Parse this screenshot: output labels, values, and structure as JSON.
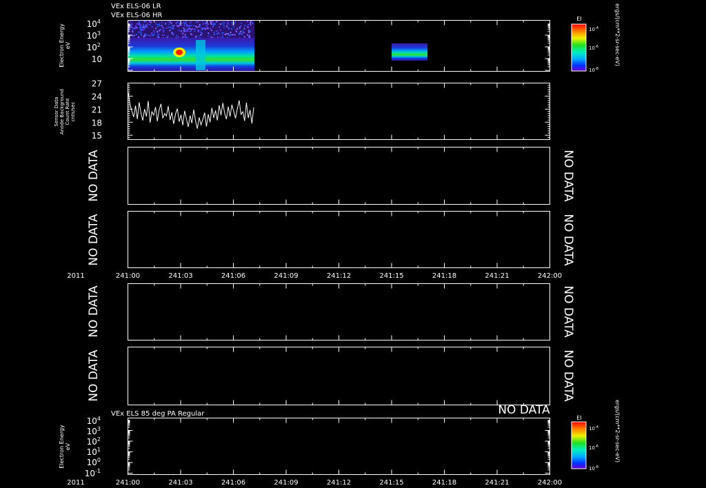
{
  "header": {
    "line1": "VEx ELS-06 LR",
    "line2": "VEx ELS-06 HR",
    "panel7_title": "VEx ELS 85 deg PA Regular"
  },
  "time_axis": {
    "year": "2011",
    "ticks": [
      "241:00",
      "241:03",
      "241:06",
      "241:09",
      "241:12",
      "241:15",
      "241:18",
      "241:21",
      "242:00"
    ]
  },
  "labels": {
    "electron_energy": "Electron Energy",
    "ev": "eV",
    "sensor_data": "Sensor Data",
    "anode_background": "Anode Background",
    "count_rate": "Count Rate",
    "cts_per_sec": "cnts/sec",
    "no_data": "NO DATA",
    "colorbar_title": "EI",
    "colorbar_units": "ergs/(cm**2-sr-sec-eV)"
  },
  "colors": {
    "background": "#000000",
    "foreground": "#ffffff",
    "spectrogram_palette": [
      "#5a00c8",
      "#0033ff",
      "#00a8ff",
      "#00f0c0",
      "#20e020",
      "#f0f000",
      "#ff8000",
      "#ff0000"
    ]
  },
  "chart_data": [
    {
      "type": "heatmap",
      "title": "VEx ELS-06 LR",
      "ylabel": "Electron Energy eV",
      "y_scale": "log",
      "yticks": [
        "10",
        "10²",
        "10³",
        "10⁴"
      ],
      "x_range": [
        "241:00",
        "242:00"
      ],
      "data_intervals": [
        {
          "start": "241:00:00",
          "end": "241:07:45",
          "note": "LR/HR spectrogram with peak flux near 241:03"
        },
        {
          "start": "241:15:10",
          "end": "241:17:00",
          "note": "short burst"
        }
      ],
      "colorbar": {
        "label": "EI",
        "ticks": [
          "10⁻⁴",
          "10⁻⁶",
          "10⁻⁸"
        ],
        "units": "ergs/(cm**2-sr-sec-eV)"
      }
    },
    {
      "type": "line",
      "ylabel": "Sensor Data Anode Background Count Rate cnts/sec",
      "ylim": [
        14,
        27
      ],
      "yticks": [
        15,
        18,
        21,
        24,
        27
      ],
      "x_range": [
        "241:00",
        "242:00"
      ],
      "series": [
        {
          "values": [
            24.8,
            22.1,
            20.5,
            19.2,
            21.8,
            18.7,
            22.6,
            20.1,
            18.4,
            21.0,
            19.3,
            22.9,
            17.9,
            20.4,
            19.6,
            21.5,
            18.2,
            20.8,
            22.2,
            18.9,
            20.0,
            19.4,
            21.7,
            18.5,
            20.3,
            17.6,
            19.9,
            21.1,
            18.1,
            19.7,
            17.3,
            20.6,
            18.8,
            16.9,
            19.5,
            17.8,
            20.9,
            18.3,
            16.5,
            19.1,
            17.4,
            18.6,
            20.2,
            17.0,
            19.8,
            18.0,
            21.3,
            19.0,
            20.7,
            18.4,
            21.9,
            19.6,
            22.4,
            20.1,
            18.7,
            21.6,
            19.3,
            22.0,
            20.5,
            18.9,
            21.2,
            23.0,
            19.8,
            20.4,
            18.3,
            22.5,
            19.0,
            20.8,
            17.7,
            21.4
          ]
        }
      ]
    },
    {
      "type": "table",
      "status": "NO DATA"
    },
    {
      "type": "table",
      "status": "NO DATA"
    },
    {
      "type": "table",
      "status": "NO DATA"
    },
    {
      "type": "table",
      "status": "NO DATA"
    },
    {
      "type": "heatmap",
      "title": "VEx ELS 85 deg PA Regular",
      "ylabel": "Electron Energy eV",
      "y_scale": "log",
      "yticks": [
        "10⁻¹",
        "10⁰",
        "10¹",
        "10²",
        "10³",
        "10⁴"
      ],
      "x_range": [
        "241:00",
        "242:00"
      ],
      "status": "NO DATA",
      "colorbar": {
        "label": "EI",
        "ticks": [
          "10⁻⁴",
          "10⁻⁶",
          "10⁻⁸"
        ],
        "units": "ergs/(cm**2-sr-sec-eV)"
      }
    }
  ]
}
